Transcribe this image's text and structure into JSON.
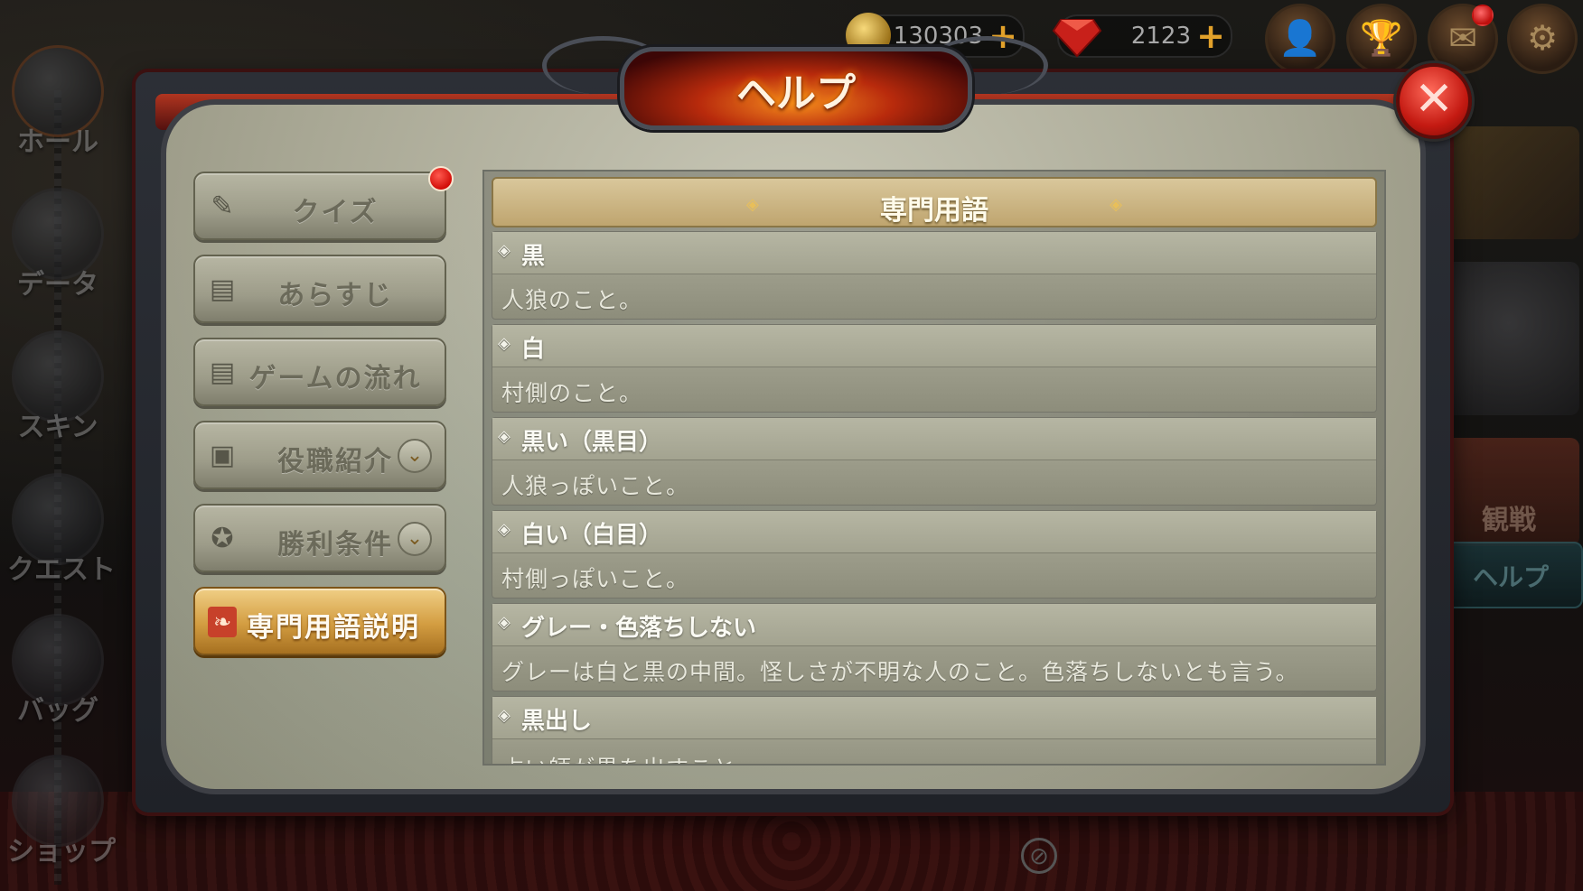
{
  "currency": {
    "gold": "130303",
    "gems": "2123",
    "plus": "+"
  },
  "left_nav": [
    {
      "label": "ホール",
      "name": "hall"
    },
    {
      "label": "データ",
      "name": "data"
    },
    {
      "label": "スキン",
      "name": "skin"
    },
    {
      "label": "クエスト",
      "name": "quest"
    },
    {
      "label": "バッグ",
      "name": "bag"
    },
    {
      "label": "ショップ",
      "name": "shop"
    }
  ],
  "right_side": {
    "watch_label": "観戦",
    "help_label": "ヘルプ"
  },
  "dialog": {
    "title": "ヘルプ",
    "close_symbol": "✕"
  },
  "menu": [
    {
      "label": "クイズ",
      "icon": "edit-icon",
      "active": false,
      "notification": true,
      "expandable": false
    },
    {
      "label": "あらすじ",
      "icon": "document-icon",
      "active": false,
      "notification": false,
      "expandable": false
    },
    {
      "label": "ゲームの流れ",
      "icon": "document-icon",
      "active": false,
      "notification": false,
      "expandable": false
    },
    {
      "label": "役職紹介",
      "icon": "id-card-icon",
      "active": false,
      "notification": false,
      "expandable": true
    },
    {
      "label": "勝利条件",
      "icon": "star-badge-icon",
      "active": false,
      "notification": false,
      "expandable": true
    },
    {
      "label": "専門用語説明",
      "icon": "book-icon",
      "active": true,
      "notification": false,
      "expandable": false
    }
  ],
  "content": {
    "header": "専門用語",
    "terms": [
      {
        "name": "黒",
        "desc": "人狼のこと。"
      },
      {
        "name": "白",
        "desc": "村側のこと。"
      },
      {
        "name": "黒い（黒目）",
        "desc": "人狼っぽいこと。"
      },
      {
        "name": "白い（白目）",
        "desc": "村側っぽいこと。"
      },
      {
        "name": "グレー・色落ちしない",
        "desc": "グレーは白と黒の中間。怪しさが不明な人のこと。色落ちしないとも言う。"
      },
      {
        "name": "黒出し",
        "desc": "占い師が黒を出すこと"
      }
    ]
  },
  "colors": {
    "accent_gold": "#d39d41",
    "close_red": "#c41a12",
    "title_fire": "#f58b1f"
  }
}
